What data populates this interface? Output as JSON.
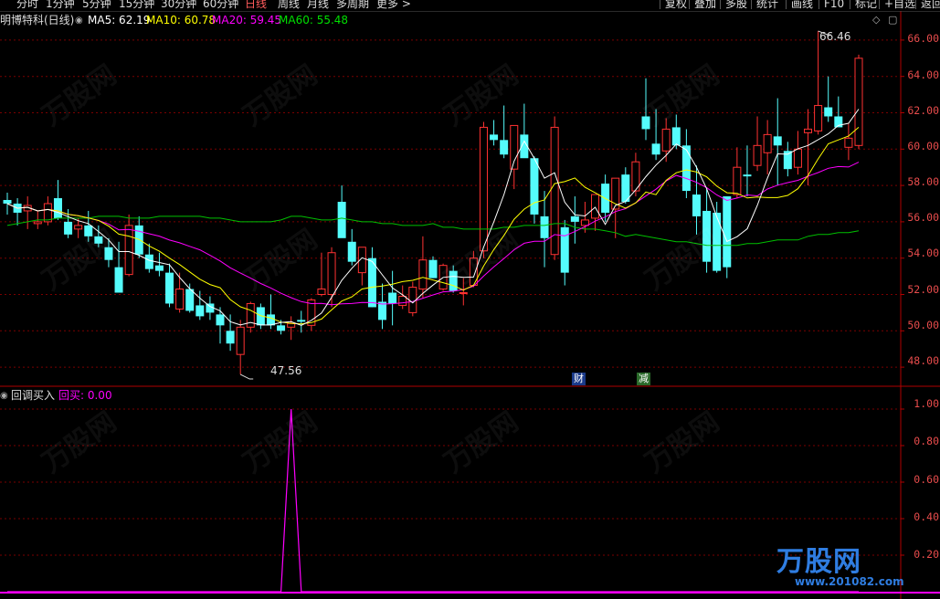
{
  "toolbar": {
    "tabs": [
      "分时",
      "1分钟",
      "5分钟",
      "15分钟",
      "30分钟",
      "60分钟",
      "日线",
      "周线",
      "月线",
      "多周期",
      "更多 >"
    ],
    "active_tab": "日线",
    "right_buttons": [
      "复权",
      "叠加",
      "多股",
      "统计",
      "画线",
      "F10",
      "标记",
      "+自选",
      "返回"
    ]
  },
  "legend": {
    "stock_name": "明博特科(日线)",
    "ma5_label": "MA5: 62.19",
    "ma10_label": "MA10: 60.78",
    "ma20_label": "MA20: 59.45",
    "ma60_label": "MA60: 55.48"
  },
  "indicator": {
    "name": "回调买入",
    "value_label": "回买: 0.00"
  },
  "annotations": {
    "high_label": "66.46",
    "low_label": "47.56",
    "badge_cai": "财",
    "badge_jian": "减"
  },
  "watermark": {
    "brand": "万股网",
    "url": "www.201082.com"
  },
  "colors": {
    "background": "#000000",
    "up_candle": "#ff3232",
    "down_candle": "#54fcfc",
    "ma5": "#ffffff",
    "ma10": "#ffff00",
    "ma20": "#ff00ff",
    "ma60": "#00c000",
    "axis": "#b00000",
    "indicator_line": "#ff00ff"
  },
  "chart_data": {
    "type": "candlestick",
    "price_axis_ticks": [
      "66.00",
      "64.00",
      "62.00",
      "60.00",
      "58.00",
      "56.00",
      "54.00",
      "52.00",
      "50.00",
      "48.00"
    ],
    "indicator_axis_ticks": [
      "1.00",
      "0.80",
      "0.60",
      "0.40",
      "0.20"
    ],
    "price_range": [
      47.0,
      67.0
    ],
    "indicator_range": [
      0,
      1.05
    ],
    "candles": [
      [
        57.2,
        57.6,
        56.4,
        57.0
      ],
      [
        57.0,
        57.3,
        55.8,
        56.5
      ],
      [
        56.6,
        57.4,
        55.6,
        56.9
      ],
      [
        55.9,
        56.6,
        55.6,
        56.0
      ],
      [
        56.0,
        57.4,
        55.8,
        57.0
      ],
      [
        57.3,
        58.3,
        56.1,
        56.2
      ],
      [
        56.0,
        56.7,
        55.1,
        55.3
      ],
      [
        55.6,
        56.2,
        55.1,
        55.8
      ],
      [
        55.8,
        56.6,
        54.9,
        55.2
      ],
      [
        55.2,
        55.8,
        54.6,
        54.8
      ],
      [
        54.6,
        55.1,
        53.5,
        53.9
      ],
      [
        53.5,
        54.9,
        52.1,
        52.1
      ],
      [
        53.1,
        56.4,
        53.0,
        55.8
      ],
      [
        55.8,
        56.3,
        54.0,
        54.2
      ],
      [
        54.2,
        54.8,
        53.2,
        53.4
      ],
      [
        53.6,
        54.3,
        53.0,
        53.3
      ],
      [
        53.2,
        53.7,
        51.3,
        51.5
      ],
      [
        51.2,
        53.2,
        51.0,
        52.3
      ],
      [
        52.3,
        52.6,
        51.0,
        51.1
      ],
      [
        51.4,
        52.2,
        50.6,
        50.8
      ],
      [
        51.5,
        51.9,
        50.6,
        51.0
      ],
      [
        50.9,
        51.3,
        49.3,
        50.3
      ],
      [
        50.0,
        50.9,
        48.9,
        49.3
      ],
      [
        48.7,
        50.6,
        47.6,
        50.2
      ],
      [
        50.2,
        51.6,
        49.9,
        51.5
      ],
      [
        51.3,
        51.5,
        50.1,
        50.3
      ],
      [
        50.9,
        52.0,
        50.1,
        50.3
      ],
      [
        50.3,
        50.6,
        49.8,
        50.0
      ],
      [
        50.2,
        50.8,
        49.5,
        50.4
      ],
      [
        50.6,
        51.1,
        49.9,
        50.5
      ],
      [
        50.3,
        51.8,
        50.0,
        51.7
      ],
      [
        52.0,
        54.3,
        51.9,
        52.3
      ],
      [
        52.0,
        54.6,
        51.3,
        54.3
      ],
      [
        57.1,
        58.0,
        55.2,
        55.1
      ],
      [
        54.9,
        55.6,
        53.6,
        53.8
      ],
      [
        53.2,
        54.6,
        52.5,
        54.6
      ],
      [
        54.0,
        54.6,
        51.3,
        51.3
      ],
      [
        51.6,
        52.6,
        50.1,
        50.6
      ],
      [
        52.1,
        53.3,
        50.3,
        51.5
      ],
      [
        51.4,
        52.5,
        51.2,
        51.9
      ],
      [
        51.0,
        52.7,
        50.8,
        52.4
      ],
      [
        52.3,
        55.2,
        51.8,
        53.9
      ],
      [
        53.9,
        54.1,
        52.9,
        52.9
      ],
      [
        52.3,
        53.7,
        52.2,
        53.6
      ],
      [
        53.3,
        53.6,
        52.1,
        52.2
      ],
      [
        52.1,
        52.9,
        51.4,
        52.1
      ],
      [
        52.5,
        54.4,
        52.4,
        54.0
      ],
      [
        54.4,
        61.5,
        54.0,
        61.2
      ],
      [
        60.8,
        61.6,
        60.2,
        60.5
      ],
      [
        60.5,
        62.4,
        59.5,
        59.7
      ],
      [
        58.9,
        61.2,
        57.8,
        61.3
      ],
      [
        60.8,
        62.5,
        59.6,
        59.5
      ],
      [
        59.5,
        59.6,
        55.9,
        56.4
      ],
      [
        56.3,
        57.7,
        53.5,
        55.1
      ],
      [
        54.2,
        61.8,
        53.9,
        61.2
      ],
      [
        55.7,
        56.1,
        52.5,
        53.2
      ],
      [
        56.3,
        57.4,
        54.8,
        56.0
      ],
      [
        55.8,
        57.1,
        55.4,
        56.1
      ],
      [
        56.2,
        57.5,
        55.5,
        57.5
      ],
      [
        58.1,
        58.6,
        56.0,
        56.5
      ],
      [
        56.7,
        58.4,
        55.1,
        58.4
      ],
      [
        58.6,
        59.0,
        57.0,
        57.1
      ],
      [
        57.7,
        59.8,
        57.4,
        59.3
      ],
      [
        61.8,
        63.9,
        60.5,
        61.1
      ],
      [
        60.3,
        62.2,
        59.4,
        59.7
      ],
      [
        59.9,
        61.7,
        59.3,
        61.1
      ],
      [
        61.2,
        61.9,
        60.0,
        60.2
      ],
      [
        60.2,
        61.1,
        57.3,
        57.7
      ],
      [
        57.5,
        59.1,
        55.3,
        56.3
      ],
      [
        56.6,
        57.8,
        53.2,
        53.8
      ],
      [
        56.5,
        57.1,
        53.2,
        53.3
      ],
      [
        57.4,
        57.4,
        52.9,
        53.5
      ],
      [
        57.5,
        60.1,
        57.3,
        59.0
      ],
      [
        58.6,
        60.2,
        57.4,
        58.5
      ],
      [
        59.1,
        61.8,
        58.8,
        60.2
      ],
      [
        59.8,
        61.6,
        58.6,
        60.8
      ],
      [
        60.7,
        62.8,
        58.0,
        60.2
      ],
      [
        59.9,
        60.4,
        58.5,
        58.9
      ],
      [
        59.0,
        61.0,
        58.6,
        60.0
      ],
      [
        60.9,
        62.2,
        58.0,
        61.1
      ],
      [
        61.0,
        66.5,
        60.8,
        62.4
      ],
      [
        62.3,
        64.0,
        61.5,
        61.8
      ],
      [
        61.8,
        62.9,
        61.4,
        61.2
      ],
      [
        60.1,
        61.4,
        59.4,
        60.6
      ],
      [
        60.2,
        65.2,
        60.0,
        65.0
      ]
    ],
    "indicator_values": [
      0,
      0,
      0,
      0,
      0,
      0,
      0,
      0,
      0,
      0,
      0,
      0,
      0,
      0,
      0,
      0,
      0,
      0,
      0,
      0,
      0,
      0,
      0,
      0,
      0,
      0,
      0,
      0,
      1,
      0,
      0,
      0,
      0,
      0,
      0,
      0,
      0,
      0,
      0,
      0,
      0,
      0,
      0,
      0,
      0,
      0,
      0,
      0,
      0,
      0,
      0,
      0,
      0,
      0,
      0,
      0,
      0,
      0,
      0,
      0,
      0,
      0,
      0,
      0,
      0,
      0,
      0,
      0,
      0,
      0,
      0,
      0,
      0,
      0,
      0,
      0,
      0,
      0,
      0,
      0,
      0,
      0,
      0,
      0,
      0
    ],
    "ma60": [
      55.8,
      55.9,
      56.0,
      56.1,
      56.1,
      56.2,
      56.2,
      56.2,
      56.2,
      56.3,
      56.3,
      56.3,
      56.2,
      56.2,
      56.2,
      56.3,
      56.3,
      56.3,
      56.3,
      56.3,
      56.2,
      56.2,
      56.1,
      56.0,
      56.0,
      56.0,
      56.0,
      56.1,
      56.3,
      56.3,
      56.2,
      56.1,
      56.1,
      56.2,
      56.1,
      56.0,
      56.0,
      55.9,
      55.9,
      55.8,
      55.8,
      55.8,
      55.9,
      55.7,
      55.7,
      55.6,
      55.6,
      55.6,
      55.6,
      55.7,
      55.7,
      55.8,
      55.8,
      55.8,
      55.9,
      55.9,
      55.7,
      55.6,
      55.6,
      55.5,
      55.4,
      55.2,
      55.3,
      55.2,
      55.1,
      55.0,
      54.9,
      54.9,
      54.8,
      54.7,
      54.7,
      54.7,
      54.7,
      54.8,
      54.8,
      54.9,
      55.0,
      55.0,
      55.0,
      55.2,
      55.3,
      55.3,
      55.4,
      55.4,
      55.5
    ]
  }
}
